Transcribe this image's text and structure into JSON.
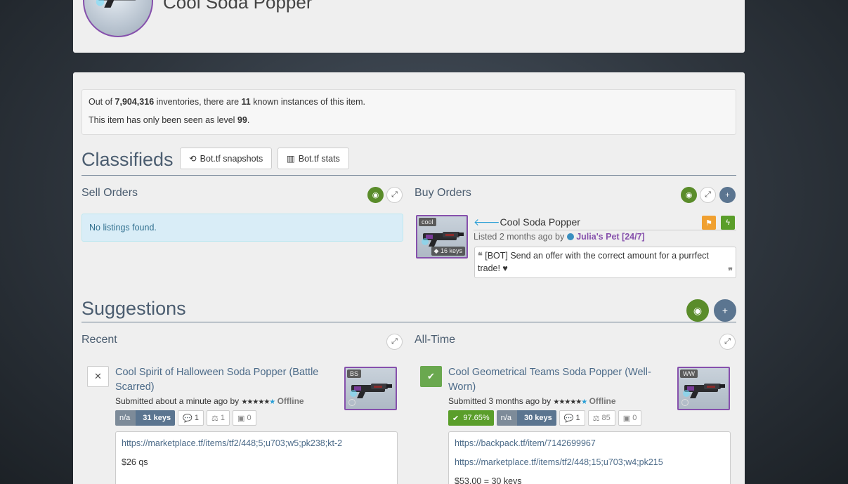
{
  "item": {
    "name": "Cool Soda Popper"
  },
  "stats": {
    "prefix": "Out of ",
    "inventories": "7,904,316",
    "mid": " inventories, there are ",
    "instances": "11",
    "suffix": " known instances of this item.",
    "level_prefix": "This item has only been seen as level ",
    "level": "99",
    "level_suffix": "."
  },
  "classifieds": {
    "title": "Classifieds",
    "btn_snapshots": "Bot.tf snapshots",
    "btn_stats": "Bot.tf stats",
    "sell": {
      "title": "Sell Orders",
      "empty": "No listings found."
    },
    "buy": {
      "title": "Buy Orders",
      "listing": {
        "quality_tag": "cool",
        "price_tag": "16 keys",
        "title": "Cool Soda Popper",
        "listed": "Listed 2 months ago by ",
        "user": "Julia's Pet [24/7]",
        "message": "[BOT] Send an offer with the correct amount for a purrfect trade! ♥"
      }
    }
  },
  "suggestions": {
    "title": "Suggestions",
    "recent": {
      "title": "Recent",
      "item": {
        "title": "Cool Spirit of Halloween Soda Popper (Battle Scarred)",
        "wear_tag": "BS",
        "submitted": "Submitted about a minute ago by ",
        "stars": "★★★★★",
        "status": "Offline",
        "current": "n/a",
        "suggested": "31 keys",
        "comments": "1",
        "votes": "1",
        "trades": "0",
        "link": "https://marketplace.tf/items/tf2/448;5;u703;w5;pk238;kt-2",
        "note": "$26 qs"
      }
    },
    "alltime": {
      "title": "All-Time",
      "item": {
        "title": "Cool Geometrical Teams Soda Popper (Well-Worn)",
        "wear_tag": "WW",
        "submitted": "Submitted 3 months ago by ",
        "stars": "★★★★★",
        "status": "Offline",
        "accepted": "97.65%",
        "current": "n/a",
        "suggested": "30 keys",
        "comments": "1",
        "votes": "85",
        "trades": "0",
        "link1": "https://backpack.tf/item/7142699967",
        "link2": "https://marketplace.tf/items/tf2/448;15;u703;w4;pk215",
        "note": "$53.00 = 30 keys"
      }
    }
  },
  "colors": {
    "unusual_border": "#8650ac",
    "accent_blue": "#5b7590",
    "accent_green": "#5a8c2a",
    "flag_orange": "#f0a030"
  },
  "icons": [
    "history-icon",
    "bar-chart-icon",
    "eye-slash-icon",
    "expand-icon",
    "plus-icon",
    "flag-icon",
    "bolt-icon",
    "quote-left-icon",
    "quote-right-icon",
    "arrow-left-icon",
    "tag-icon",
    "times-icon",
    "check-icon",
    "comment-icon",
    "balance-icon",
    "briefcase-icon"
  ]
}
